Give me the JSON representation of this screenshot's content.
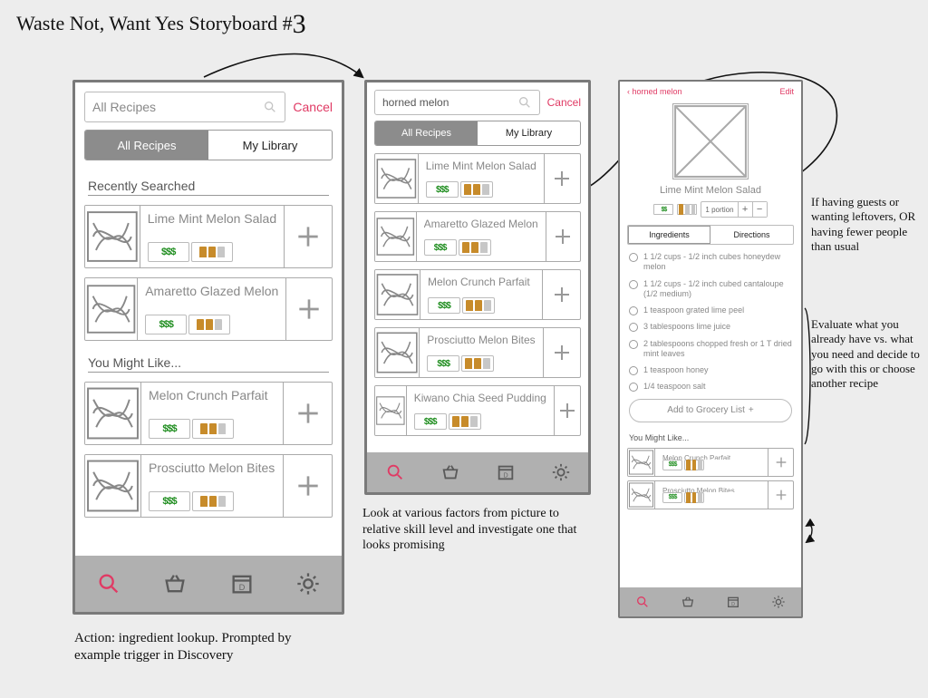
{
  "title_main": "Waste Not, Want Yes Storyboard #",
  "title_num": "3",
  "annotations": {
    "bottom_left": "Action: ingredient lookup. Prompted by example trigger in Discovery",
    "bottom_mid": "Look at various factors from picture to relative skill level and investigate one that looks promising",
    "right_top": "If having guests or wanting leftovers, OR having fewer people than usual",
    "right_mid": "Evaluate what you already have vs. what you need and decide to go with this or choose another recipe"
  },
  "common": {
    "cancel": "Cancel",
    "tabs": {
      "all": "All Recipes",
      "mine": "My Library"
    },
    "add_to_grocery": "Add to Grocery List",
    "you_might_like": "You Might Like...",
    "recently_searched": "Recently Searched"
  },
  "phoneA": {
    "search_placeholder": "All Recipes",
    "rows1": [
      {
        "name": "Lime Mint Melon Salad"
      },
      {
        "name": "Amaretto Glazed Melon"
      }
    ],
    "rows2": [
      {
        "name": "Melon Crunch Parfait"
      },
      {
        "name": "Prosciutto Melon Bites"
      }
    ]
  },
  "phoneB": {
    "search_value": "horned melon",
    "rows": [
      {
        "name": "Lime Mint Melon Salad"
      },
      {
        "name": "Amaretto Glazed Melon"
      },
      {
        "name": "Melon Crunch Parfait"
      },
      {
        "name": "Prosciutto Melon Bites"
      },
      {
        "name": "Kiwano Chia Seed Pudding"
      }
    ]
  },
  "phoneC": {
    "back": "‹ horned melon",
    "edit": "Edit",
    "recipe_title": "Lime Mint Melon Salad",
    "portion_label": "1 portion",
    "seg_ingredients": "Ingredients",
    "seg_directions": "Directions",
    "ingredients": [
      "1 1/2 cups - 1/2 inch cubes honeydew melon",
      "1 1/2 cups - 1/2 inch cubed cantaloupe (1/2 medium)",
      "1 teaspoon grated lime peel",
      "3 tablespoons lime juice",
      "2 tablespoons chopped fresh or 1 T dried mint leaves",
      "1 teaspoon honey",
      "1/4 teaspoon salt"
    ],
    "suggest": [
      {
        "name": "Melon Crunch Parfait"
      },
      {
        "name": "Prosciutto Melon Bites"
      }
    ]
  }
}
